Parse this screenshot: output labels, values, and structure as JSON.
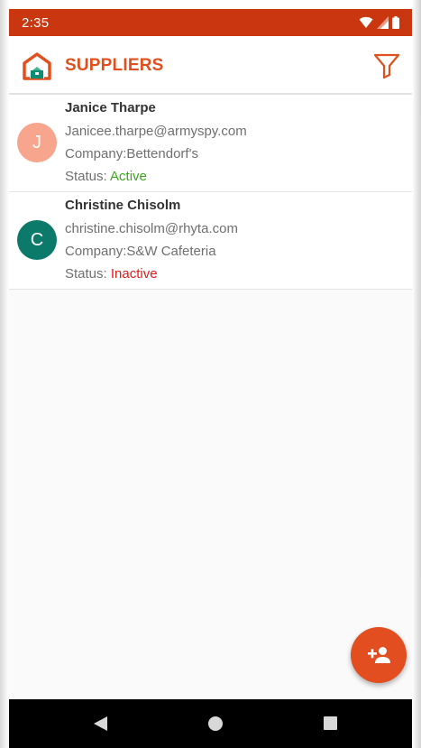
{
  "status_bar": {
    "time": "2:35",
    "icons": [
      "wifi-icon",
      "signal-icon",
      "battery-icon"
    ]
  },
  "app_bar": {
    "title": "SUPPLIERS",
    "logo_icon": "warehouse-icon",
    "filter_icon": "filter-icon"
  },
  "suppliers": [
    {
      "initial": "J",
      "avatar_color": "#f7a58c",
      "name": "Janice Tharpe",
      "email": "Janicee.tharpe@armyspy.com",
      "company": "Company:Bettendorf's",
      "status_label": "Status: ",
      "status": "Active",
      "status_color": "#3aa81a"
    },
    {
      "initial": "C",
      "avatar_color": "#0b7a6a",
      "name": "Christine Chisolm",
      "email": "christine.chisolm@rhyta.com",
      "company": "Company:S&W Cafeteria",
      "status_label": "Status: ",
      "status": "Inactive",
      "status_color": "#e21a1a"
    }
  ],
  "fab": {
    "icon": "add-person-icon"
  },
  "colors": {
    "accent": "#e0501e",
    "status_bar": "#c9360f"
  },
  "nav_bar": {
    "icons": [
      "back-icon",
      "home-icon",
      "recents-icon"
    ]
  }
}
